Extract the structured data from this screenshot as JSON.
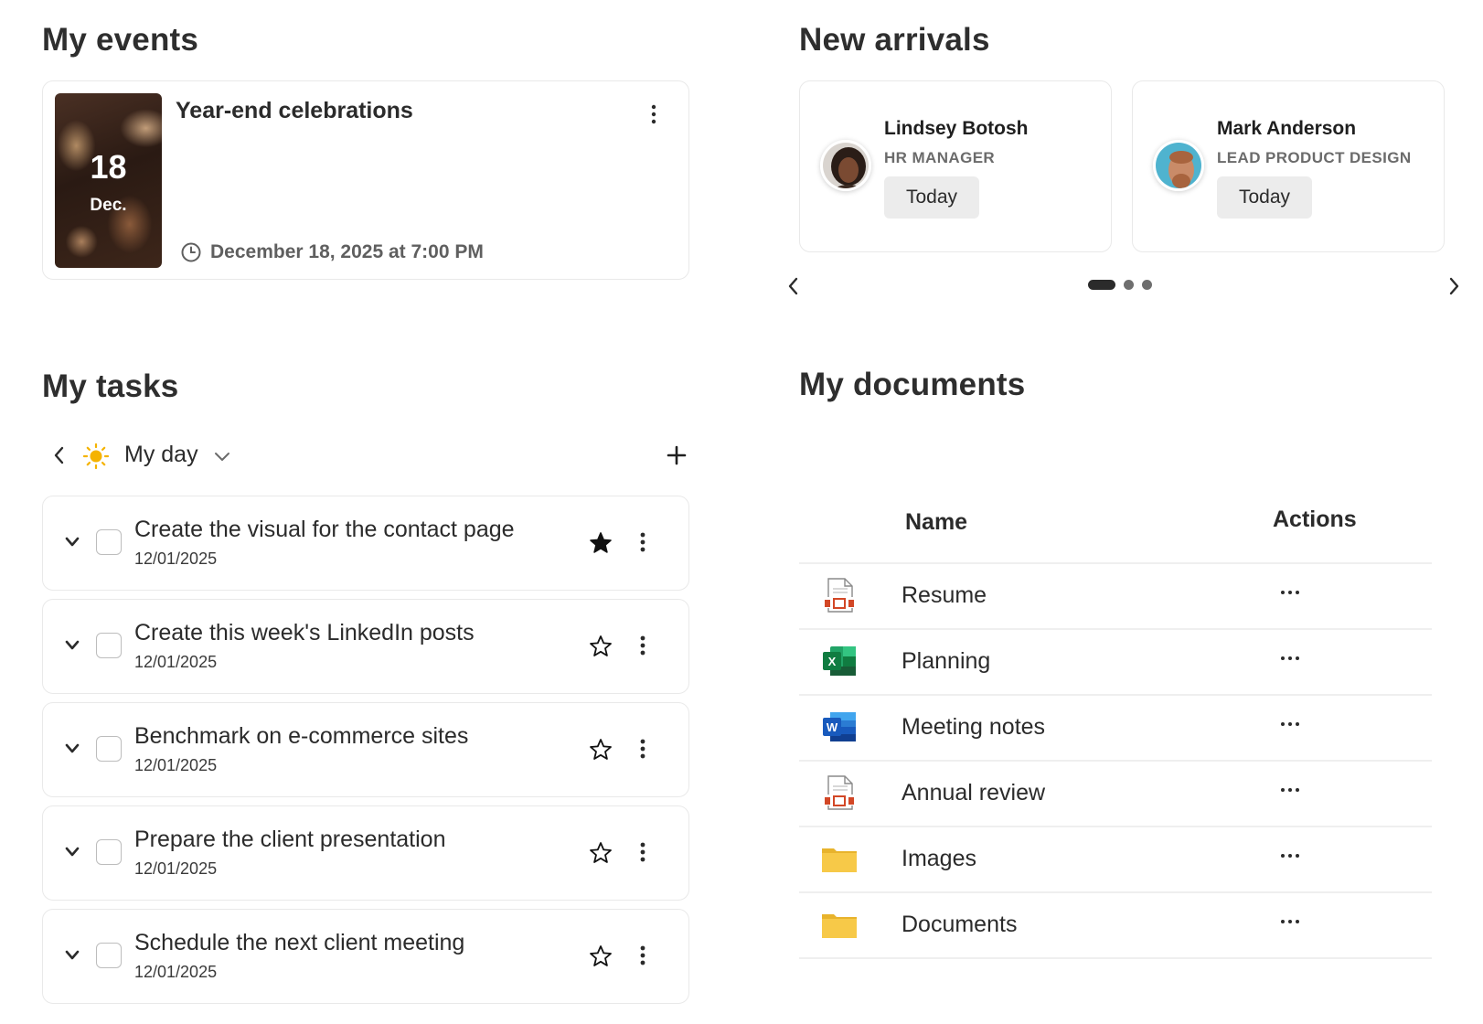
{
  "events": {
    "title": "My events",
    "card": {
      "day": "18",
      "month": "Dec.",
      "title": "Year-end celebrations",
      "datetime": "December 18, 2025 at 7:00 PM",
      "menu_icon": "more-vertical-icon",
      "time_icon": "clock-icon"
    }
  },
  "arrivals": {
    "title": "New arrivals",
    "people": [
      {
        "name": "Lindsey Botosh",
        "role": "HR MANAGER",
        "badge": "Today",
        "avatar": "avatar-photo"
      },
      {
        "name": "Mark Anderson",
        "role": "LEAD PRODUCT DESIGN",
        "badge": "Today",
        "avatar": "avatar-photo"
      }
    ],
    "carousel": {
      "pages": 3,
      "active_page": 1,
      "prev_icon": "chevron-left-icon",
      "next_icon": "chevron-right-icon"
    }
  },
  "tasks": {
    "title": "My tasks",
    "filter_label": "My day",
    "filter_icon": "sun-icon",
    "accent": "#f5b301",
    "items": [
      {
        "title": "Create the visual for the contact page",
        "date": "12/01/2025",
        "starred": true,
        "checked": false
      },
      {
        "title": "Create this week's LinkedIn posts",
        "date": "12/01/2025",
        "starred": false,
        "checked": false
      },
      {
        "title": "Benchmark on e-commerce sites",
        "date": "12/01/2025",
        "starred": false,
        "checked": false
      },
      {
        "title": "Prepare the client presentation",
        "date": "12/01/2025",
        "starred": false,
        "checked": false
      },
      {
        "title": "Schedule the next client meeting",
        "date": "12/01/2025",
        "starred": false,
        "checked": false
      }
    ]
  },
  "documents": {
    "title": "My documents",
    "columns": {
      "name": "Name",
      "actions": "Actions"
    },
    "rows": [
      {
        "name": "Resume",
        "type": "pdf-icon"
      },
      {
        "name": "Planning",
        "type": "excel-icon"
      },
      {
        "name": "Meeting notes",
        "type": "word-icon"
      },
      {
        "name": "Annual review",
        "type": "pdf-icon"
      },
      {
        "name": "Images",
        "type": "folder-icon"
      },
      {
        "name": "Documents",
        "type": "folder-icon"
      }
    ],
    "colors": {
      "excel": "#1d7044",
      "word": "#1f5fbf",
      "folder": "#f7c948",
      "pdf": "#d24726"
    }
  }
}
